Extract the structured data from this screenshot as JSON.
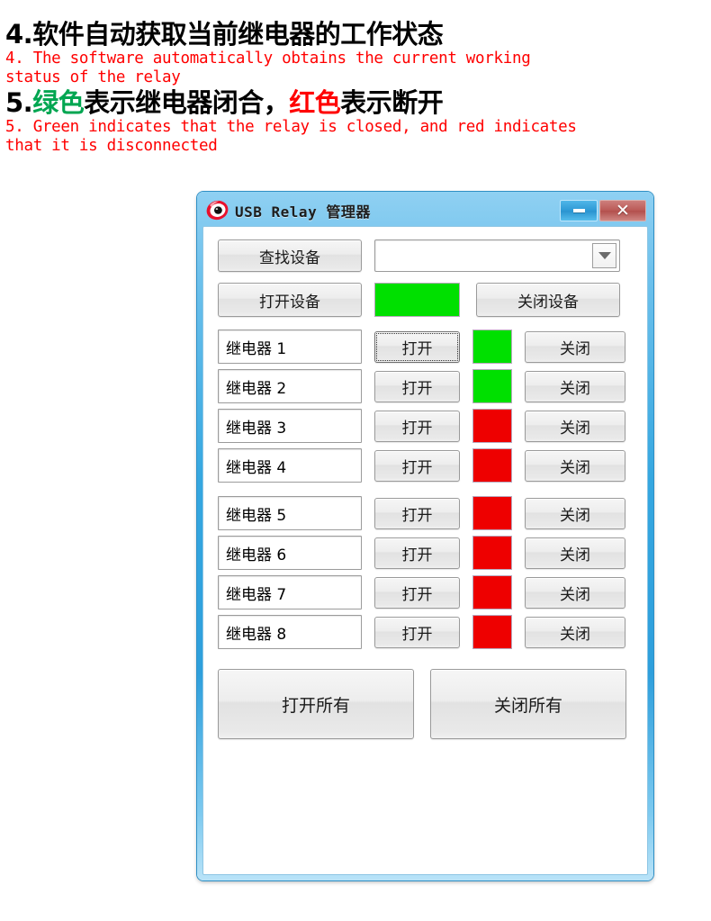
{
  "instructions": {
    "item4": {
      "chinese_prefix": "4.",
      "chinese": "软件自动获取当前继电器的工作状态",
      "english": "4. The software automatically obtains the current working\nstatus of the relay"
    },
    "item5": {
      "chinese_prefix": "5.",
      "chinese_green": "绿色",
      "chinese_mid": "表示继电器闭合，",
      "chinese_red": "红色",
      "chinese_tail": "表示断开",
      "english": "5. Green indicates that the relay is closed, and red indicates\nthat it is disconnected"
    }
  },
  "window": {
    "title": "USB Relay 管理器",
    "icon": "eye-icon",
    "minimize_label": "—",
    "close_label": "✕"
  },
  "device_panel": {
    "find_device_label": "查找设备",
    "combo_value": "",
    "combo_placeholder": "",
    "combo_arrow": "chevron-down-icon",
    "open_device_label": "打开设备",
    "close_device_label": "关闭设备",
    "device_status_color": "#00e000"
  },
  "relays": {
    "on_label": "打开",
    "off_label": "关闭",
    "rows": [
      {
        "name": "继电器 1",
        "status_color": "#00e000",
        "state": "closed",
        "focused": true
      },
      {
        "name": "继电器 2",
        "status_color": "#00e000",
        "state": "closed",
        "focused": false
      },
      {
        "name": "继电器 3",
        "status_color": "#ee0000",
        "state": "open",
        "focused": false
      },
      {
        "name": "继电器 4",
        "status_color": "#ee0000",
        "state": "open",
        "focused": false
      },
      {
        "name": "继电器 5",
        "status_color": "#ee0000",
        "state": "open",
        "focused": false
      },
      {
        "name": "继电器 6",
        "status_color": "#ee0000",
        "state": "open",
        "focused": false
      },
      {
        "name": "继电器 7",
        "status_color": "#ee0000",
        "state": "open",
        "focused": false
      },
      {
        "name": "继电器 8",
        "status_color": "#ee0000",
        "state": "open",
        "focused": false
      }
    ]
  },
  "bulk": {
    "open_all_label": "打开所有",
    "close_all_label": "关闭所有"
  },
  "colors": {
    "green": "#00e000",
    "red": "#ee0000",
    "title_bar_blue": "#35a7e0",
    "instruction_red": "#ff0000",
    "instruction_green": "#00a651"
  }
}
